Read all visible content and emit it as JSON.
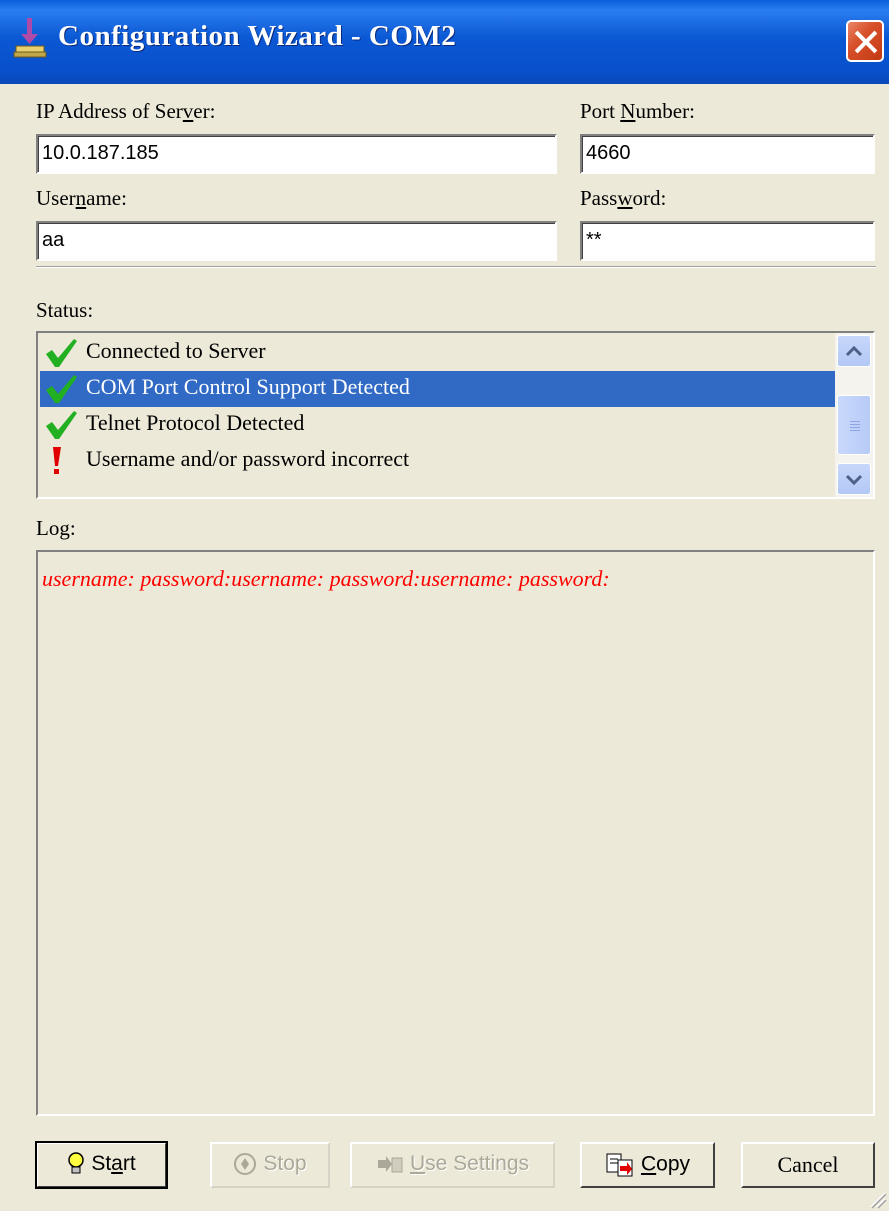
{
  "window": {
    "title": "Configuration Wizard - COM2",
    "icon": "installer-icon"
  },
  "fields": {
    "ip_label_pre": "IP Address of Ser",
    "ip_label_acc": "v",
    "ip_label_post": "er:",
    "ip_value": "10.0.187.185",
    "port_label_pre": "Port ",
    "port_label_acc": "N",
    "port_label_post": "umber:",
    "port_value": "4660",
    "user_label_pre": "User",
    "user_label_acc": "n",
    "user_label_post": "ame:",
    "user_value": "aa",
    "pass_label_pre": "Pass",
    "pass_label_acc": "w",
    "pass_label_post": "ord:",
    "pass_value": "**"
  },
  "status": {
    "label": "Status:",
    "items": [
      {
        "text": "Connected to Server",
        "icon": "check-icon",
        "selected": false
      },
      {
        "text": "COM Port Control Support Detected",
        "icon": "check-icon",
        "selected": true
      },
      {
        "text": "Telnet Protocol Detected",
        "icon": "check-icon",
        "selected": false
      },
      {
        "text": "Username and/or password incorrect",
        "icon": "exclamation-icon",
        "selected": false
      }
    ]
  },
  "log": {
    "label": "Log:",
    "text": "username: password:username: password:username: password:",
    "color": "#ff0000"
  },
  "buttons": {
    "start": {
      "pre": "St",
      "acc": "a",
      "post": "rt",
      "icon": "lightbulb-icon"
    },
    "stop": {
      "pre": "Stop",
      "icon": "stop-icon",
      "disabled": true
    },
    "use_settings": {
      "acc": "U",
      "post": "se Settings",
      "icon": "use-settings-icon",
      "disabled": true
    },
    "copy": {
      "acc": "C",
      "post": "opy",
      "icon": "copy-icon"
    },
    "cancel": {
      "label": "Cancel"
    }
  },
  "colors": {
    "titlebar": "#0a58d4",
    "selection": "#316ac5",
    "dialog_bg": "#ece9d8"
  }
}
